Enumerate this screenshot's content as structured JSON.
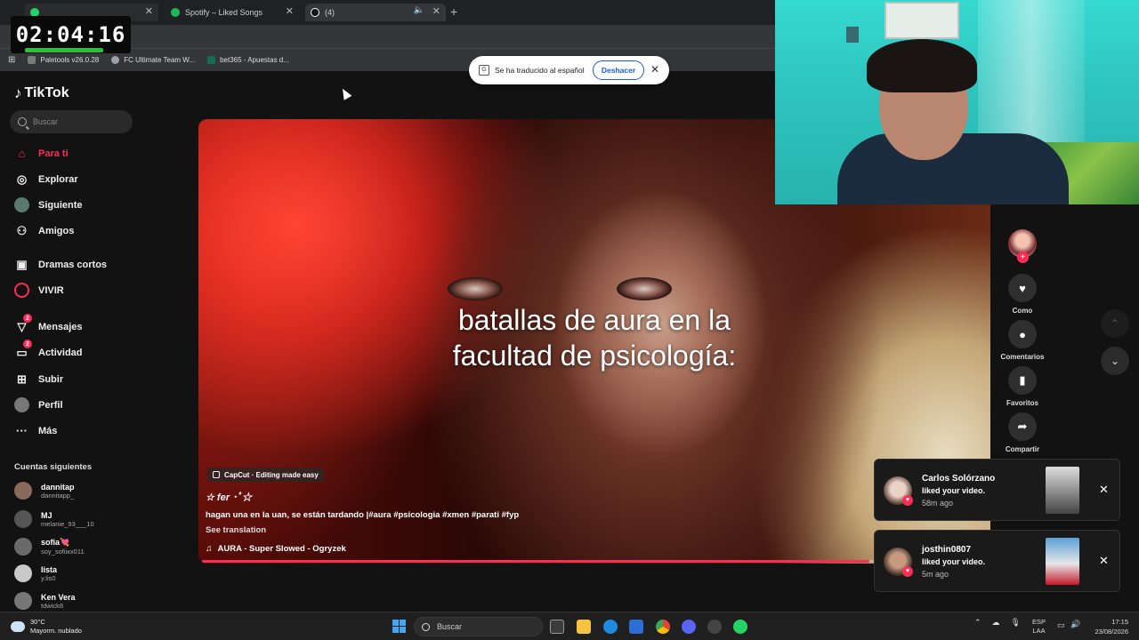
{
  "timer": "02:04:16",
  "browser": {
    "tabs": [
      {
        "label": "",
        "icon": "whatsapp-icon"
      },
      {
        "label": "Spotify – Liked Songs",
        "icon": "spotify-icon"
      },
      {
        "label": "(4)",
        "icon": "tiktok-icon"
      }
    ],
    "bookmarks": [
      {
        "label": "Paletools v26.0.28",
        "icon": "paletools-icon"
      },
      {
        "label": "FC Ultimate Team W...",
        "icon": "globe-icon"
      },
      {
        "label": "bet365 - Apuestas d...",
        "icon": "bet365-icon"
      }
    ]
  },
  "translate_popup": {
    "message": "Se ha traducido al español",
    "undo_label": "Deshacer"
  },
  "tiktok": {
    "logo": "TikTok",
    "search_placeholder": "Buscar",
    "nav": [
      {
        "label": "Para ti",
        "icon": "home-icon",
        "active": true
      },
      {
        "label": "Explorar",
        "icon": "compass-icon"
      },
      {
        "label": "Siguiente",
        "icon": "following-avatar-icon"
      },
      {
        "label": "Amigos",
        "icon": "friends-icon"
      },
      {
        "label": "Dramas cortos",
        "icon": "film-icon"
      },
      {
        "label": "VIVIR",
        "icon": "live-icon"
      },
      {
        "label": "Mensajes",
        "icon": "message-icon",
        "badge": "2"
      },
      {
        "label": "Actividad",
        "icon": "activity-icon",
        "badge": "2"
      },
      {
        "label": "Subir",
        "icon": "upload-icon"
      },
      {
        "label": "Perfil",
        "icon": "profile-icon"
      },
      {
        "label": "Más",
        "icon": "more-icon"
      }
    ],
    "following_title": "Cuentas siguientes",
    "following": [
      {
        "name": "dannitap",
        "handle": "dannitapp_"
      },
      {
        "name": "MJ",
        "handle": "melanie_93___10"
      },
      {
        "name": "sofia💘",
        "handle": "soy_sofiixx011"
      },
      {
        "name": "lista",
        "handle": "y.lis0"
      },
      {
        "name": "Ken Vera",
        "handle": "tdwick8"
      }
    ],
    "video": {
      "overlay_text": "batallas de aura en la facultad de psicología:",
      "capcut_label": "CapCut · Editing made easy",
      "author": "☆ fer ･ﾟ☆",
      "description": "hagan una en la uan, se están tardando |#aura #psicologia #xmen #parati #fyp",
      "see_translation": "See translation",
      "music": "AURA - Super Slowed - Ogryzek",
      "progress": 0.85
    },
    "actions": [
      {
        "label": "Como",
        "icon": "heart-icon"
      },
      {
        "label": "Comentarios",
        "icon": "comment-icon"
      },
      {
        "label": "Favoritos",
        "icon": "bookmark-icon"
      },
      {
        "label": "Compartir",
        "icon": "share-icon"
      }
    ]
  },
  "notifications": [
    {
      "name": "Carlos Solórzano",
      "text": "liked your video.",
      "time": "58m ago"
    },
    {
      "name": "josthin0807",
      "text": "liked your video.",
      "time": "5m ago"
    }
  ],
  "taskbar": {
    "weather_temp": "30°C",
    "weather_desc": "Mayorm. nublado",
    "search_placeholder": "Buscar",
    "lang_top": "ESP",
    "lang_bottom": "LAA",
    "time": "17:15",
    "date": "23/08/2026"
  }
}
